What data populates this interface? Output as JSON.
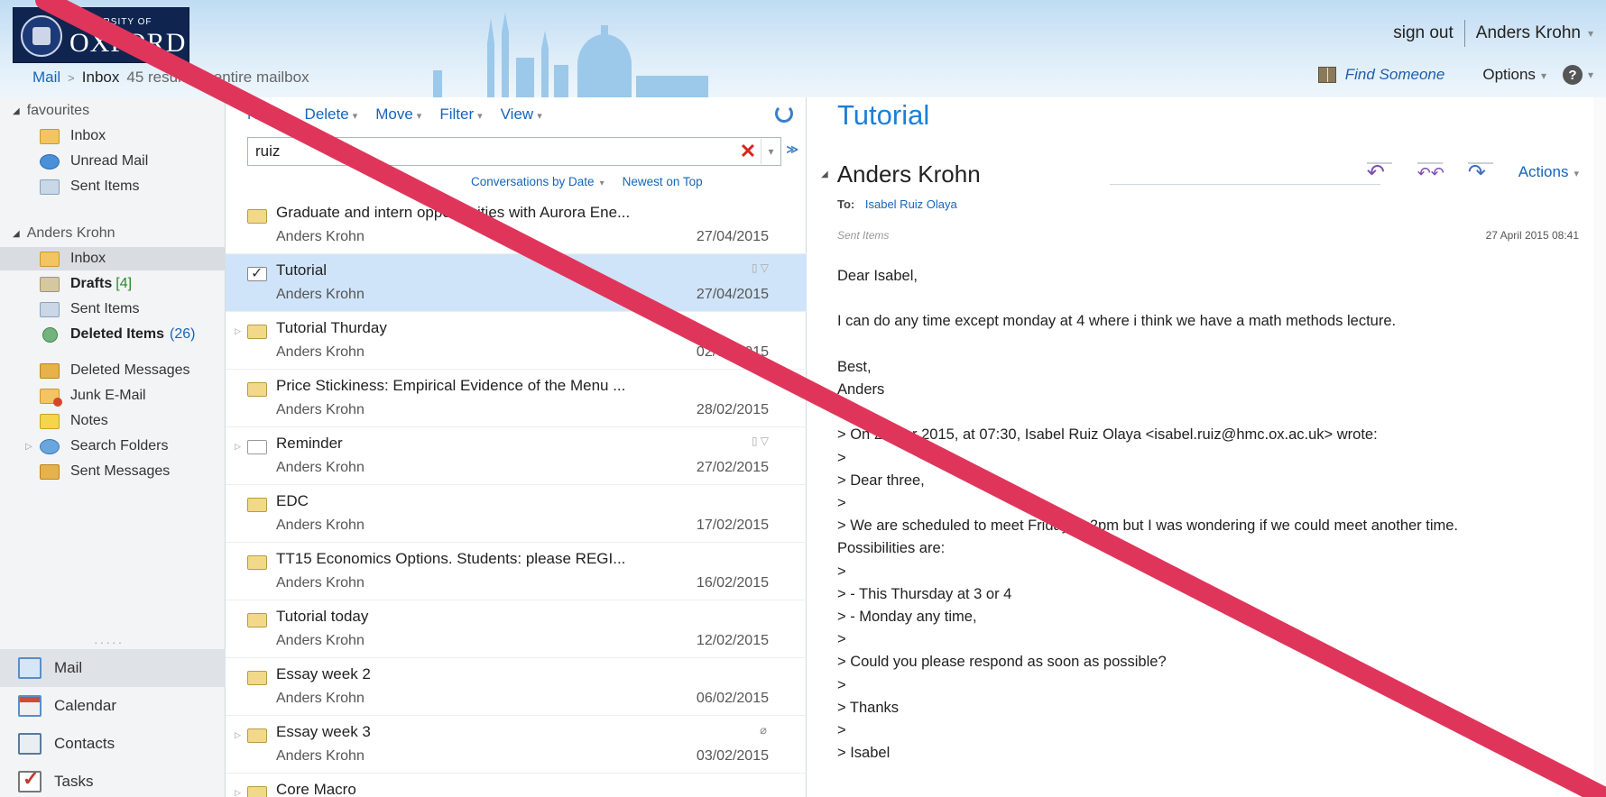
{
  "header": {
    "logo_small": "UNIVERSITY OF",
    "logo_big": "OXFORD",
    "sign_out": "sign out",
    "user": "Anders Krohn",
    "find_someone": "Find Someone",
    "options": "Options"
  },
  "breadcrumb": {
    "mail": "Mail",
    "separator": ">",
    "inbox": "Inbox",
    "results": "45 results in entire mailbox"
  },
  "nav": {
    "favourites_label": "favourites",
    "favourites": [
      {
        "label": "Inbox",
        "icon": "inbox-folder-icon"
      },
      {
        "label": "Unread Mail",
        "icon": "search-folder-icon"
      },
      {
        "label": "Sent Items",
        "icon": "sent-items-icon"
      }
    ],
    "account_label": "Anders Krohn",
    "folders": [
      {
        "label": "Inbox",
        "count": ""
      },
      {
        "label": "Drafts",
        "count": "4"
      },
      {
        "label": "Sent Items",
        "count": ""
      },
      {
        "label": "Deleted Items",
        "count": "26"
      },
      {
        "label": "Deleted Messages",
        "count": ""
      },
      {
        "label": "Junk E-Mail",
        "count": ""
      },
      {
        "label": "Notes",
        "count": ""
      },
      {
        "label": "Search Folders",
        "count": ""
      },
      {
        "label": "Sent Messages",
        "count": ""
      }
    ],
    "bottom": [
      {
        "label": "Mail"
      },
      {
        "label": "Calendar"
      },
      {
        "label": "Contacts"
      },
      {
        "label": "Tasks"
      }
    ]
  },
  "list": {
    "toolbar": {
      "new": "New",
      "delete": "Delete",
      "move": "Move",
      "filter": "Filter",
      "view": "View"
    },
    "search_value": "ruiz",
    "arrange_by": "Conversations by Date",
    "sort": "Newest on Top",
    "messages": [
      {
        "subject": "Graduate and intern opportunities with Aurora Ene...",
        "from": "Anders Krohn",
        "date": "27/04/2015"
      },
      {
        "subject": "Tutorial",
        "from": "Anders Krohn",
        "date": "27/04/2015"
      },
      {
        "subject": "Tutorial Thurday",
        "from": "Anders Krohn",
        "date": "02/03/2015"
      },
      {
        "subject": "Price Stickiness: Empirical Evidence of the Menu ...",
        "from": "Anders Krohn",
        "date": "28/02/2015"
      },
      {
        "subject": "Reminder",
        "from": "Anders Krohn",
        "date": "27/02/2015"
      },
      {
        "subject": "EDC",
        "from": "Anders Krohn",
        "date": "17/02/2015"
      },
      {
        "subject": "TT15 Economics Options. Students: please REGI...",
        "from": "Anders Krohn",
        "date": "16/02/2015"
      },
      {
        "subject": "Tutorial today",
        "from": "Anders Krohn",
        "date": "12/02/2015"
      },
      {
        "subject": "Essay week 2",
        "from": "Anders Krohn",
        "date": "06/02/2015"
      },
      {
        "subject": "Essay week 3",
        "from": "Anders Krohn",
        "date": "03/02/2015"
      },
      {
        "subject": "Core Macro",
        "from": "",
        "date": ""
      }
    ]
  },
  "reading": {
    "title": "Tutorial",
    "sender": "Anders Krohn",
    "actions": "Actions",
    "to_label": "To:",
    "to_name": "Isabel Ruiz Olaya",
    "folder": "Sent Items",
    "date": "27 April 2015 08:41",
    "body": [
      "Dear Isabel,",
      "",
      "I can do any time except monday at 4 where i think we have a math methods lecture.",
      "",
      "Best,",
      "Anders",
      "",
      "> On 27 Apr 2015, at 07:30, Isabel Ruiz Olaya <isabel.ruiz@hmc.ox.ac.uk> wrote:",
      ">",
      "> Dear three,",
      ">",
      "> We are scheduled to meet Friday at 2pm but I was wondering if we could meet another time.",
      "Possibilities are:",
      ">",
      "> - This Thursday at 3 or 4",
      "> - Monday any time,",
      ">",
      "> Could you please respond as soon as possible?",
      ">",
      "> Thanks",
      ">",
      "> Isabel"
    ]
  },
  "colors": {
    "accent": "#1c7fd6",
    "link": "#1665ba",
    "selected_row": "#cfe4f8",
    "overlay_stroke": "#e0355a"
  }
}
